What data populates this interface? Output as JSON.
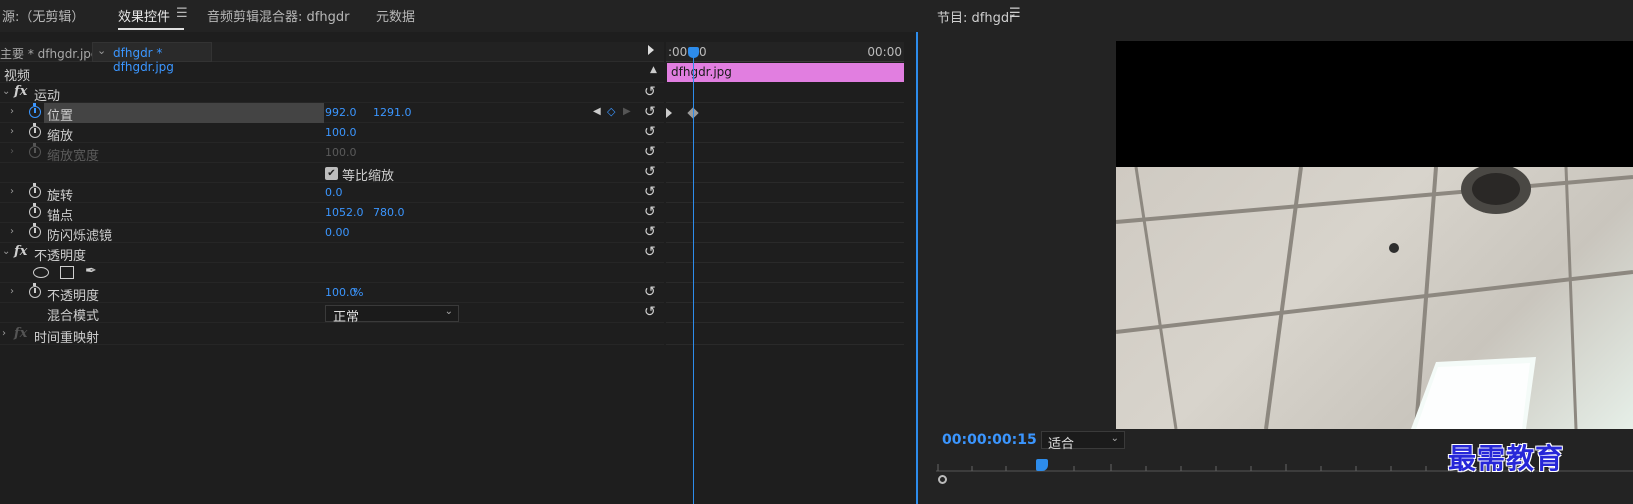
{
  "left_tabs": {
    "source": "源:（无剪辑）",
    "effect_controls": "效果控件",
    "audio_mixer": "音频剪辑混合器: dfhgdr",
    "metadata": "元数据",
    "menu_icon": "☰"
  },
  "subheader": {
    "master": "主要 * dfhgdr.jpg",
    "clip": "dfhgdr * dfhgdr.jpg"
  },
  "timeline": {
    "start": ":00:00",
    "end": "00:00",
    "clip_name": "dfhgdr.jpg"
  },
  "video_section": "视频",
  "motion": {
    "label": "运动",
    "position": {
      "label": "位置",
      "x": "992.0",
      "y": "1291.0"
    },
    "scale": {
      "label": "缩放",
      "value": "100.0"
    },
    "scale_width": {
      "label": "缩放宽度",
      "value": "100.0"
    },
    "uniform_scale": "等比缩放",
    "rotation": {
      "label": "旋转",
      "value": "0.0"
    },
    "anchor": {
      "label": "锚点",
      "x": "1052.0",
      "y": "780.0"
    },
    "flicker": {
      "label": "防闪烁滤镜",
      "value": "0.00"
    }
  },
  "opacity": {
    "label": "不透明度",
    "opacity": {
      "label": "不透明度",
      "value": "100.0",
      "unit": "%"
    },
    "blend": {
      "label": "混合模式",
      "value": "正常"
    }
  },
  "time_remap": "时间重映射",
  "program": {
    "title": "节目: dfhgdr",
    "menu_icon": "☰",
    "timecode": "00:00:00:15",
    "fit": "适合"
  },
  "watermark": "最需教育",
  "colors": {
    "accent": "#2d8ceb",
    "clip": "#e17ee0",
    "value_blue": "#3b96ff"
  }
}
